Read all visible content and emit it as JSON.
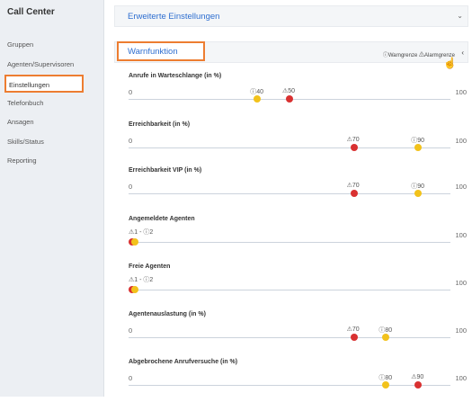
{
  "sidebar": {
    "title": "Call Center",
    "items": [
      {
        "label": "Gruppen"
      },
      {
        "label": "Agenten/Supervisoren"
      },
      {
        "label": "Einstellungen",
        "active": true
      },
      {
        "label": "Telefonbuch"
      },
      {
        "label": "Ansagen"
      },
      {
        "label": "Skills/Status"
      },
      {
        "label": "Reporting"
      }
    ]
  },
  "header": {
    "title": "Erweiterte Einstellungen",
    "chevron": "chevron-down-icon"
  },
  "warnfunktion": {
    "title": "Warnfunktion",
    "legend_warn": "Warngrenze",
    "legend_alarm": "Alarmgrenze",
    "collapse": "chevron-left-icon"
  },
  "colors": {
    "warn": "#f2c21b",
    "alarm": "#d93131",
    "accent": "#ed7d31",
    "link": "#2f6fd0"
  },
  "sections": [
    {
      "title": "Anrufe in Warteschlange (in %)",
      "min": "0",
      "max": "100",
      "warn": {
        "text": "40",
        "pos": 0.4
      },
      "alarm": {
        "text": "50",
        "pos": 0.5
      }
    },
    {
      "title": "Erreichbarkeit (in %)",
      "min": "0",
      "max": "100",
      "alarm": {
        "text": "70",
        "pos": 0.7
      },
      "warn": {
        "text": "90",
        "pos": 0.9
      }
    },
    {
      "title": "Erreichbarkeit VIP (in %)",
      "min": "0",
      "max": "100",
      "alarm": {
        "text": "70",
        "pos": 0.7
      },
      "warn": {
        "text": "90",
        "pos": 0.9
      }
    },
    {
      "title": "Angemeldete Agenten",
      "min": "",
      "max": "100",
      "alarm": {
        "text": "1",
        "pos": 0.01
      },
      "warn": {
        "text": "2",
        "pos": 0.02
      },
      "combined": true
    },
    {
      "title": "Freie Agenten",
      "min": "",
      "max": "100",
      "alarm": {
        "text": "1",
        "pos": 0.01
      },
      "warn": {
        "text": "2",
        "pos": 0.02
      },
      "combined": true
    },
    {
      "title": "Agentenauslastung (in %)",
      "min": "0",
      "max": "100",
      "alarm": {
        "text": "70",
        "pos": 0.7
      },
      "warn": {
        "text": "80",
        "pos": 0.8
      }
    },
    {
      "title": "Abgebrochene Anrufversuche (in %)",
      "min": "0",
      "max": "100",
      "warn": {
        "text": "80",
        "pos": 0.8
      },
      "alarm": {
        "text": "90",
        "pos": 0.9
      }
    }
  ]
}
